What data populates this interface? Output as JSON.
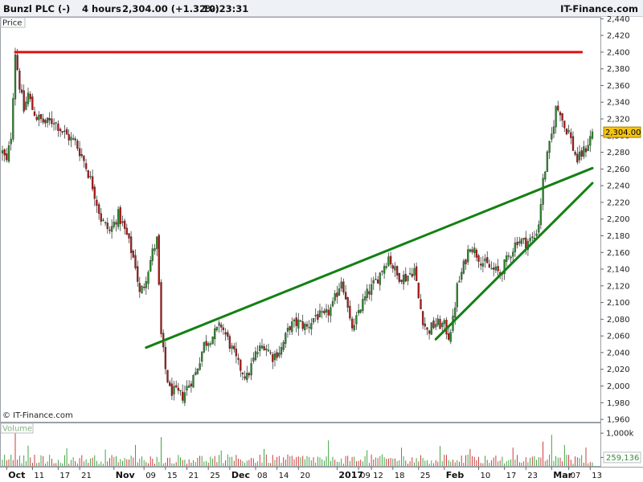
{
  "header": {
    "instrument": "Bunzl PLC (-)",
    "timeframe": "4 hours",
    "quote": "2,304.00 (+1.32%)",
    "time": "10:23:31",
    "brand": "IT-Finance.com"
  },
  "panels": {
    "price_label": "Price",
    "volume_label": "Volume",
    "watermark": "© IT-Finance.com"
  },
  "colors": {
    "up": "#2c8a2c",
    "down": "#b01818",
    "resistance": "#e01010",
    "trendline": "#138013",
    "last_price_bg": "#f6c412",
    "volume_up": "#2c9a2c",
    "volume_down": "#c42828"
  },
  "chart_data": {
    "type": "candlestick",
    "price_axis": {
      "ylim": [
        1950,
        2450
      ],
      "ticks": [
        1960,
        1980,
        2000,
        2020,
        2040,
        2060,
        2080,
        2100,
        2120,
        2140,
        2160,
        2180,
        2200,
        2220,
        2240,
        2260,
        2280,
        2300,
        2320,
        2340,
        2360,
        2380,
        2400,
        2420,
        2440
      ],
      "tick_labels": [
        "1,960",
        "1,980",
        "2,000",
        "2,020",
        "2,040",
        "2,060",
        "2,080",
        "2,100",
        "2,120",
        "2,140",
        "2,160",
        "2,180",
        "2,200",
        "2,220",
        "2,240",
        "2,260",
        "2,280",
        "2,300",
        "2,320",
        "2,340",
        "2,360",
        "2,380",
        "2,400",
        "2,420",
        "2,440"
      ],
      "last_price": 2304,
      "last_price_label": "2,304.00"
    },
    "volume_axis": {
      "ylim": [
        0,
        1300000
      ],
      "ticks": [
        1000000,
        259136
      ],
      "tick_labels": [
        "1,000k",
        "259,136"
      ]
    },
    "x_axis": {
      "ticks": [
        {
          "label": "Oct",
          "bar": 2,
          "bold": true
        },
        {
          "label": "11",
          "bar": 14
        },
        {
          "label": "17",
          "bar": 26
        },
        {
          "label": "21",
          "bar": 36
        },
        {
          "label": "Nov",
          "bar": 52,
          "bold": true
        },
        {
          "label": "09",
          "bar": 66
        },
        {
          "label": "15",
          "bar": 76
        },
        {
          "label": "21",
          "bar": 86
        },
        {
          "label": "25",
          "bar": 96
        },
        {
          "label": "Dec",
          "bar": 106,
          "bold": true
        },
        {
          "label": "08",
          "bar": 118
        },
        {
          "label": "14",
          "bar": 128
        },
        {
          "label": "20",
          "bar": 138
        },
        {
          "label": "2017",
          "bar": 156,
          "bold": true
        },
        {
          "label": "09",
          "bar": 166
        },
        {
          "label": "12",
          "bar": 172
        },
        {
          "label": "18",
          "bar": 182
        },
        {
          "label": "25",
          "bar": 194
        },
        {
          "label": "Feb",
          "bar": 206,
          "bold": true
        },
        {
          "label": "10",
          "bar": 222
        },
        {
          "label": "17",
          "bar": 234
        },
        {
          "label": "23",
          "bar": 244
        },
        {
          "label": "Mar",
          "bar": 256,
          "bold": true
        },
        {
          "label": "07",
          "bar": 264
        },
        {
          "label": "13",
          "bar": 274
        }
      ]
    },
    "bar_count": 276,
    "price_path": [
      [
        0,
        2280
      ],
      [
        2,
        2268
      ],
      [
        4,
        2300
      ],
      [
        6,
        2400
      ],
      [
        8,
        2360
      ],
      [
        10,
        2330
      ],
      [
        12,
        2350
      ],
      [
        14,
        2332
      ],
      [
        16,
        2322
      ],
      [
        20,
        2315
      ],
      [
        24,
        2318
      ],
      [
        28,
        2305
      ],
      [
        30,
        2300
      ],
      [
        34,
        2292
      ],
      [
        38,
        2270
      ],
      [
        42,
        2240
      ],
      [
        46,
        2200
      ],
      [
        50,
        2185
      ],
      [
        54,
        2205
      ],
      [
        58,
        2180
      ],
      [
        62,
        2145
      ],
      [
        64,
        2110
      ],
      [
        66,
        2122
      ],
      [
        70,
        2160
      ],
      [
        72,
        2175
      ],
      [
        74,
        2060
      ],
      [
        76,
        2020
      ],
      [
        78,
        1995
      ],
      [
        80,
        1993
      ],
      [
        84,
        1988
      ],
      [
        86,
        1998
      ],
      [
        90,
        2015
      ],
      [
        94,
        2050
      ],
      [
        98,
        2060
      ],
      [
        102,
        2073
      ],
      [
        106,
        2050
      ],
      [
        110,
        2025
      ],
      [
        114,
        2010
      ],
      [
        118,
        2038
      ],
      [
        122,
        2050
      ],
      [
        126,
        2035
      ],
      [
        130,
        2045
      ],
      [
        134,
        2072
      ],
      [
        138,
        2076
      ],
      [
        142,
        2070
      ],
      [
        146,
        2085
      ],
      [
        150,
        2082
      ],
      [
        154,
        2096
      ],
      [
        158,
        2128
      ],
      [
        160,
        2108
      ],
      [
        162,
        2075
      ],
      [
        164,
        2068
      ],
      [
        166,
        2090
      ],
      [
        170,
        2110
      ],
      [
        174,
        2125
      ],
      [
        178,
        2145
      ],
      [
        180,
        2155
      ],
      [
        184,
        2132
      ],
      [
        188,
        2130
      ],
      [
        192,
        2140
      ],
      [
        194,
        2105
      ],
      [
        196,
        2080
      ],
      [
        198,
        2065
      ],
      [
        202,
        2075
      ],
      [
        206,
        2072
      ],
      [
        208,
        2060
      ],
      [
        210,
        2078
      ],
      [
        212,
        2118
      ],
      [
        214,
        2135
      ],
      [
        218,
        2170
      ],
      [
        220,
        2162
      ],
      [
        224,
        2148
      ],
      [
        228,
        2140
      ],
      [
        232,
        2135
      ],
      [
        236,
        2155
      ],
      [
        240,
        2175
      ],
      [
        244,
        2172
      ],
      [
        248,
        2178
      ],
      [
        250,
        2195
      ],
      [
        252,
        2245
      ],
      [
        254,
        2275
      ],
      [
        256,
        2300
      ],
      [
        258,
        2332
      ],
      [
        260,
        2330
      ],
      [
        262,
        2310
      ],
      [
        264,
        2305
      ],
      [
        266,
        2285
      ],
      [
        268,
        2270
      ],
      [
        270,
        2278
      ],
      [
        272,
        2285
      ],
      [
        275,
        2304
      ]
    ],
    "overlay_lines": [
      {
        "name": "resistance",
        "points": [
          [
            6,
            2400
          ],
          [
            270,
            2400
          ]
        ],
        "color": "#e01010"
      },
      {
        "name": "trendline-upper",
        "points": [
          [
            67,
            2046
          ],
          [
            275,
            2261
          ]
        ],
        "color": "#138013"
      },
      {
        "name": "trendline-lower",
        "points": [
          [
            202,
            2056
          ],
          [
            275,
            2243
          ]
        ],
        "color": "#138013"
      }
    ],
    "volume": {
      "base": 160000,
      "spikes": [
        [
          6,
          1050000
        ],
        [
          12,
          620000
        ],
        [
          30,
          540000
        ],
        [
          48,
          500000
        ],
        [
          62,
          640000
        ],
        [
          74,
          880000
        ],
        [
          102,
          470000
        ],
        [
          122,
          520000
        ],
        [
          152,
          780000
        ],
        [
          170,
          480000
        ],
        [
          186,
          560000
        ],
        [
          204,
          610000
        ],
        [
          218,
          520000
        ],
        [
          238,
          560000
        ],
        [
          252,
          740000
        ],
        [
          256,
          950000
        ],
        [
          262,
          640000
        ],
        [
          272,
          560000
        ]
      ]
    }
  }
}
